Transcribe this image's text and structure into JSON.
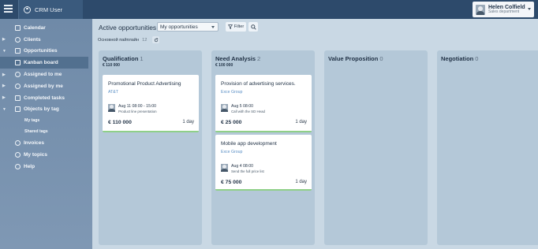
{
  "header": {
    "app_title": "CRM User",
    "user_name": "Helen Colfield",
    "user_department": "Sales department"
  },
  "sidebar": {
    "items": [
      {
        "label": "Calendar",
        "icon": "calendar-icon"
      },
      {
        "label": "Clients",
        "icon": "clients-icon"
      },
      {
        "label": "Opportunities",
        "icon": "opportunities-icon"
      },
      {
        "label": "Kanban board",
        "icon": "kanban-icon",
        "active": true
      },
      {
        "label": "Assigned to me",
        "icon": "assigned-icon"
      },
      {
        "label": "Assigned by me",
        "icon": "assigned-by-icon"
      },
      {
        "label": "Completed tasks",
        "icon": "completed-tasks-icon"
      },
      {
        "label": "Objects by tag",
        "icon": "tag-icon"
      },
      {
        "label": "My tags",
        "sub": true
      },
      {
        "label": "Shared tags",
        "sub": true
      },
      {
        "label": "Invoices",
        "icon": "invoices-icon"
      },
      {
        "label": "My topics",
        "icon": "topics-icon"
      },
      {
        "label": "Help",
        "icon": "help-icon"
      }
    ]
  },
  "toolbar": {
    "title": "Active opportunities",
    "select_value": "My opportunities",
    "filter_label": "Filter"
  },
  "pipeline": {
    "label": "Основной пайплайн",
    "count": "12"
  },
  "columns": [
    {
      "title": "Qualification",
      "count": "1",
      "sum": "€ 110 000",
      "cards": [
        {
          "title": "Promotional Product Advertising",
          "company": "AT&T",
          "activity_time": "Aug 11 08:00 - 15:00",
          "activity_desc": "Product line presentation",
          "amount": "€ 110 000",
          "days": "1 day"
        }
      ]
    },
    {
      "title": "Need Analysis",
      "count": "2",
      "sum": "€ 100 000",
      "cards": [
        {
          "title": "Provision of advertising services.",
          "company": "Exce Group",
          "activity_time": "Aug 5 08:00",
          "activity_desc": "Call with the SD Head",
          "amount": "€ 25 000",
          "days": "1 day"
        },
        {
          "title": "Mobile app development",
          "company": "Exce Group",
          "activity_time": "Aug 4 08:00",
          "activity_desc": "Send the full price list",
          "amount": "€ 75 000",
          "days": "1 day"
        }
      ]
    },
    {
      "title": "Value Proposition",
      "count": "0",
      "sum": "",
      "cards": []
    },
    {
      "title": "Negotiation",
      "count": "0",
      "sum": "",
      "cards": []
    }
  ],
  "colors": {
    "topbar": "#2d4a6b",
    "sidebar": "#7590ad",
    "board": "#c9d8e4",
    "column": "#b4c8d8",
    "card_accent": "#8fd088",
    "company_link": "#5a8fc5"
  }
}
